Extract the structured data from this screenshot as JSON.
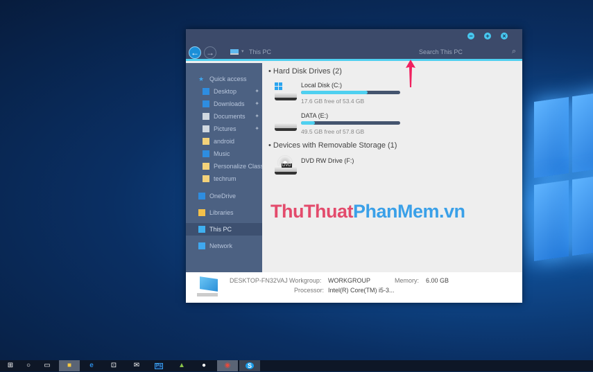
{
  "window": {
    "controls": [
      "minimize",
      "maximize",
      "close"
    ],
    "breadcrumb": "This PC",
    "search_placeholder": "Search This PC"
  },
  "sidebar": {
    "items": [
      {
        "label": "Quick access",
        "icon": "star-icon",
        "color": "#3fa8f0"
      },
      {
        "label": "Desktop",
        "icon": "desktop-icon",
        "color": "#2e8de0",
        "pinned": true
      },
      {
        "label": "Downloads",
        "icon": "download-icon",
        "color": "#2e8de0",
        "pinned": true
      },
      {
        "label": "Documents",
        "icon": "documents-icon",
        "color": "#d0d8e0",
        "pinned": true
      },
      {
        "label": "Pictures",
        "icon": "pictures-icon",
        "color": "#d0d8e0",
        "pinned": true
      },
      {
        "label": "android",
        "icon": "folder-icon",
        "color": "#f3d27a"
      },
      {
        "label": "Music",
        "icon": "music-icon",
        "color": "#2e8de0"
      },
      {
        "label": "Personalize Classic",
        "icon": "folder-icon",
        "color": "#f3d27a"
      },
      {
        "label": "techrum",
        "icon": "folder-icon",
        "color": "#f3d27a"
      },
      {
        "label": "OneDrive",
        "icon": "onedrive-icon",
        "color": "#2e8de0"
      },
      {
        "label": "Libraries",
        "icon": "libraries-icon",
        "color": "#f3c04a"
      },
      {
        "label": "This PC",
        "icon": "pc-icon",
        "color": "#3fb0f0",
        "selected": true
      },
      {
        "label": "Network",
        "icon": "network-icon",
        "color": "#3fa8f0"
      }
    ],
    "pin_glyph": "📌"
  },
  "content": {
    "hdd_group": "Hard Disk Drives (2)",
    "drives": [
      {
        "name": "Local Disk (C:)",
        "free": "17.6 GB free of 53.4 GB",
        "used_percent": 67
      },
      {
        "name": "DATA (E:)",
        "free": "49.5 GB free of 57.8 GB",
        "used_percent": 14
      }
    ],
    "removable_group": "Devices with Removable Storage (1)",
    "dvd": {
      "name": "DVD RW Drive (F:)",
      "badge": "DVD"
    }
  },
  "footer": {
    "computer": "DESKTOP-FN32VAJ",
    "workgroup_label": "Workgroup:",
    "workgroup": "WORKGROUP",
    "memory_label": "Memory:",
    "memory": "6.00 GB",
    "processor_label": "Processor:",
    "processor": "Intel(R) Core(TM) i5-3..."
  },
  "watermark": {
    "part1": "ThuThuat",
    "part2": "PhanMem.vn"
  },
  "taskbar": {
    "apps": [
      "start",
      "cortana",
      "task-view",
      "file-explorer",
      "edge",
      "store",
      "mail",
      "photoshop",
      "android",
      "app",
      "chrome",
      "skype"
    ],
    "ps_label": "Ps",
    "skype_label": "S",
    "edge_label": "e"
  }
}
